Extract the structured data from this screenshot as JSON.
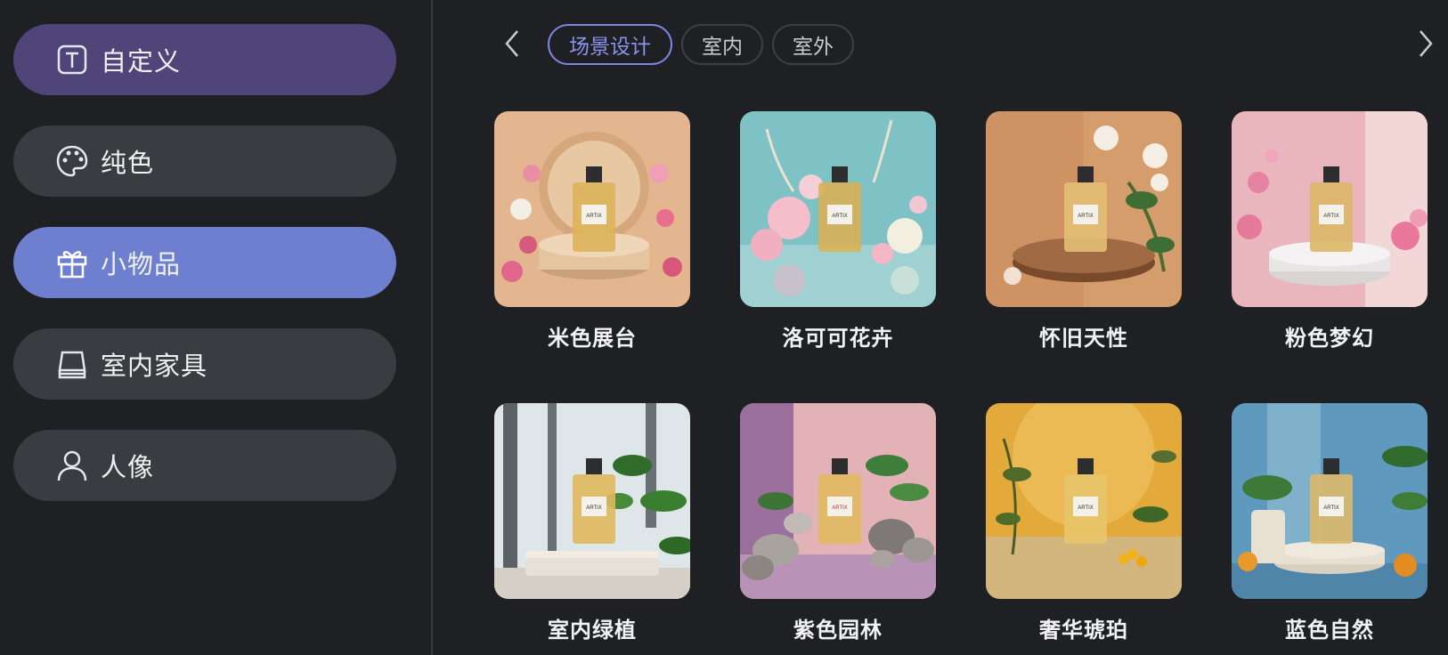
{
  "sidebar": {
    "items": [
      {
        "label": "自定义",
        "icon": "text-box-icon"
      },
      {
        "label": "纯色",
        "icon": "palette-icon"
      },
      {
        "label": "小物品",
        "icon": "gift-icon"
      },
      {
        "label": "室内家具",
        "icon": "furniture-icon"
      },
      {
        "label": "人像",
        "icon": "person-icon"
      }
    ]
  },
  "tabs": {
    "items": [
      "场景设计",
      "室内",
      "室外"
    ],
    "prev_icon": "chevron-left-icon",
    "next_icon": "chevron-right-icon"
  },
  "cards": [
    {
      "caption": "米色展台",
      "bottle_text": "ARTIX"
    },
    {
      "caption": "洛可可花卉",
      "bottle_text": "ARTIX"
    },
    {
      "caption": "怀旧天性",
      "bottle_text": "ARTIX"
    },
    {
      "caption": "粉色梦幻",
      "bottle_text": "ARTIX"
    },
    {
      "caption": "室内绿植",
      "bottle_text": "ARTIX"
    },
    {
      "caption": "紫色园林",
      "bottle_text": "ARTIX"
    },
    {
      "caption": "奢华琥珀",
      "bottle_text": "ARTIX"
    },
    {
      "caption": "蓝色自然",
      "bottle_text": "ARTIX"
    }
  ],
  "colors": {
    "background": "#1e2024",
    "active_item": "#6e7fd0",
    "custom_item": "#4f4579",
    "tab_active": "#7d86e0"
  }
}
